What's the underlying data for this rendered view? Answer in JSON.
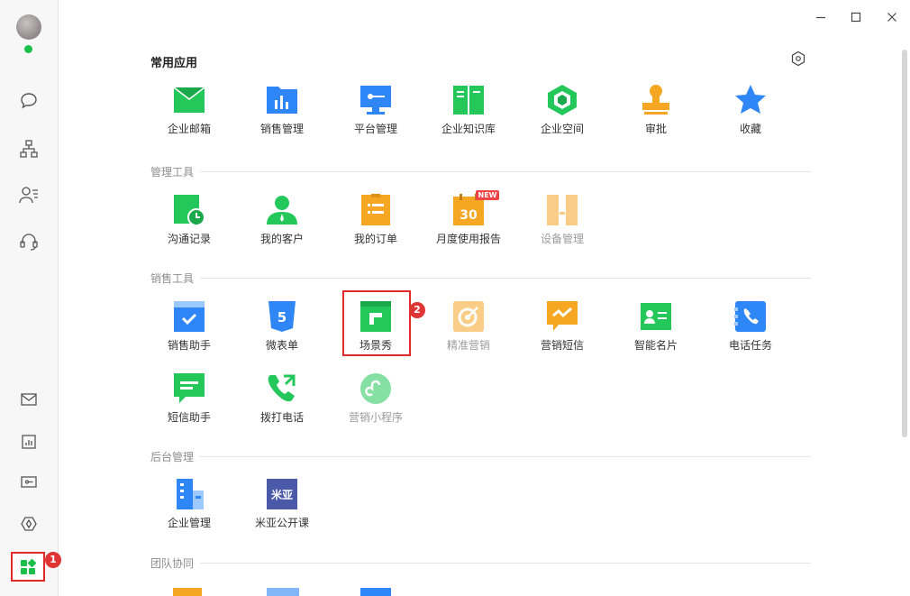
{
  "window": {
    "minimize_label": "",
    "maximize_label": "",
    "close_label": ""
  },
  "sections": {
    "common": "常用应用",
    "manage": "管理工具",
    "sales": "销售工具",
    "backend": "后台管理",
    "team": "团队协同"
  },
  "apps": {
    "mail": "企业邮箱",
    "sales_mgmt": "销售管理",
    "platform_mgmt": "平台管理",
    "knowledge": "企业知识库",
    "space": "企业空间",
    "approval": "审批",
    "favorites": "收藏",
    "comm_record": "沟通记录",
    "my_customers": "我的客户",
    "my_orders": "我的订单",
    "monthly_report": "月度使用报告",
    "device_mgmt": "设备管理",
    "sales_assistant": "销售助手",
    "micro_form": "微表单",
    "scene_show": "场景秀",
    "precision_marketing": "精准营销",
    "marketing_sms": "营销短信",
    "smart_card": "智能名片",
    "phone_task": "电话任务",
    "sms_assistant": "短信助手",
    "dial_phone": "拨打电话",
    "mini_program": "营销小程序",
    "enterprise_mgmt": "企业管理",
    "miya_course": "米亚公开课"
  },
  "tags": {
    "new": "NEW",
    "miya_icon_text": "米亚",
    "h5_text": "5",
    "calendar_text": "30"
  },
  "badges": {
    "step1": "1",
    "step2": "2"
  },
  "colors": {
    "accent_green": "#1cbf4a",
    "highlight_red": "#e02b2b",
    "blue": "#2f86f6",
    "orange": "#f5a623"
  }
}
